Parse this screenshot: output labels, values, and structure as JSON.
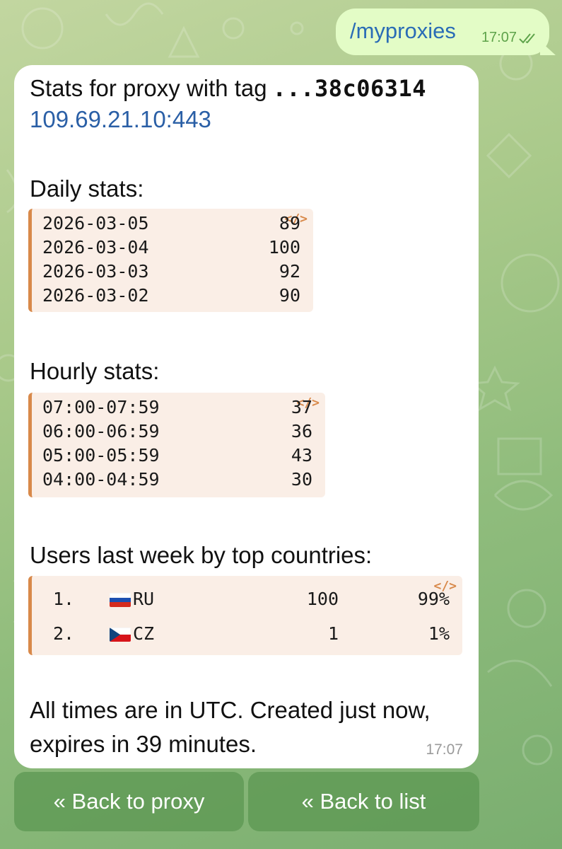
{
  "outgoing": {
    "text": "/myproxies",
    "time": "17:07",
    "status_icon": "double-check-icon"
  },
  "message": {
    "title_prefix": "Stats for proxy with tag",
    "tag": "...38c06314",
    "proxy_link": "109.69.21.10:443",
    "daily": {
      "label": "Daily stats:",
      "rows": [
        {
          "date": "2026-03-05",
          "value": "89"
        },
        {
          "date": "2026-03-04",
          "value": "100"
        },
        {
          "date": "2026-03-03",
          "value": "92"
        },
        {
          "date": "2026-03-02",
          "value": "90"
        }
      ]
    },
    "hourly": {
      "label": "Hourly stats:",
      "rows": [
        {
          "range": "07:00-07:59",
          "value": "37"
        },
        {
          "range": "06:00-06:59",
          "value": "36"
        },
        {
          "range": "05:00-05:59",
          "value": "43"
        },
        {
          "range": "04:00-04:59",
          "value": "30"
        }
      ]
    },
    "countries": {
      "label": "Users last week by top countries:",
      "rows": [
        {
          "index": "1.",
          "flag": "flag-ru-icon",
          "code": "RU",
          "count": "100",
          "percent": "99%"
        },
        {
          "index": "2.",
          "flag": "flag-cz-icon",
          "code": "CZ",
          "count": "1",
          "percent": "1%"
        }
      ]
    },
    "footer": "All times are in UTC. Created just now, expires in 39 minutes.",
    "time": "17:07",
    "copy_icon": "code-icon"
  },
  "keyboard": {
    "back_to_proxy": "« Back to proxy",
    "back_to_list": "« Back to list"
  },
  "colors": {
    "out_bubble": "#e3fcc6",
    "link": "#2a5fa6",
    "code_accent": "#d8894a",
    "code_bg": "#faeee6",
    "button_bg": "#5a9650"
  }
}
